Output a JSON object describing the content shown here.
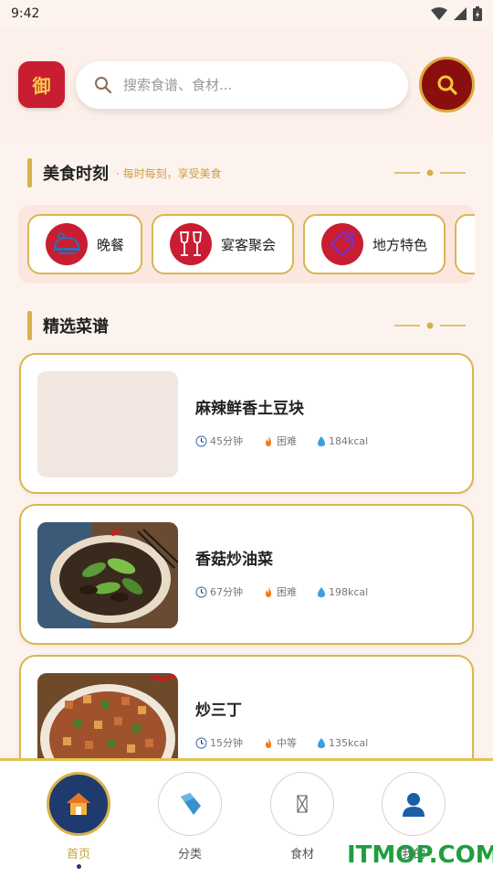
{
  "status_bar": {
    "time": "9:42"
  },
  "header": {
    "logo_text": "御",
    "search_placeholder": "搜索食谱、食材...",
    "search_icon": "search-icon"
  },
  "sections": {
    "food_moment": {
      "title": "美食时刻",
      "subtitle": "· 每时每刻，享受美食"
    },
    "featured": {
      "title": "精选菜谱"
    }
  },
  "categories": [
    {
      "label": "晚餐",
      "icon": "roast-chicken-icon"
    },
    {
      "label": "宴客聚会",
      "icon": "wine-glasses-icon"
    },
    {
      "label": "地方特色",
      "icon": "tag-icon"
    }
  ],
  "recipes": [
    {
      "name": "麻辣鲜香土豆块",
      "time": "45分钟",
      "difficulty": "困难",
      "calories": "184kcal"
    },
    {
      "name": "香菇炒油菜",
      "time": "67分钟",
      "difficulty": "困难",
      "calories": "198kcal"
    },
    {
      "name": "炒三丁",
      "time": "15分钟",
      "difficulty": "中等",
      "calories": "135kcal"
    }
  ],
  "tabs": [
    {
      "label": "首页",
      "icon": "home-icon",
      "active": true
    },
    {
      "label": "分类",
      "icon": "category-icon",
      "active": false
    },
    {
      "label": "食材",
      "icon": "ingredient-icon",
      "active": false
    },
    {
      "label": "我的",
      "icon": "user-icon",
      "active": false
    }
  ],
  "watermark": "ITMOP.COM",
  "colors": {
    "brand_red": "#c91d32",
    "gold": "#d9b651",
    "dark_red": "#8b0e0e",
    "navy": "#1f3a6e",
    "background": "#fdf3ee"
  }
}
